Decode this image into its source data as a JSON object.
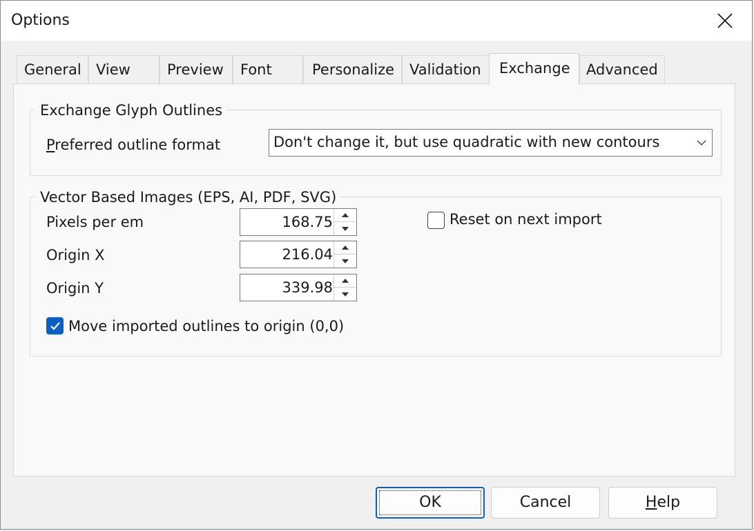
{
  "window": {
    "title": "Options"
  },
  "tabs": [
    {
      "label": "General"
    },
    {
      "label": "View"
    },
    {
      "label": "Preview"
    },
    {
      "label": "Font"
    },
    {
      "label": "Personalize"
    },
    {
      "label": "Validation"
    },
    {
      "label": "Exchange",
      "active": true
    },
    {
      "label": "Advanced"
    }
  ],
  "exchange_glyph": {
    "group_title": "Exchange Glyph Outlines",
    "format_label_accel": "P",
    "format_label_rest": "referred outline format",
    "format_value": "Don't change it, but use quadratic with new contours"
  },
  "vector_images": {
    "group_title": "Vector Based Images (EPS, AI, PDF, SVG)",
    "pixels_per_em_label": "Pixels per em",
    "pixels_per_em_value": "168.75",
    "origin_x_label": "Origin X",
    "origin_x_value": "216.04",
    "origin_y_label": "Origin Y",
    "origin_y_value": "339.98",
    "reset_label": "Reset on next import",
    "reset_checked": false,
    "move_label": "Move imported outlines to origin (0,0)",
    "move_checked": true
  },
  "buttons": {
    "ok": "OK",
    "cancel": "Cancel",
    "help_accel": "H",
    "help_rest": "elp"
  },
  "colors": {
    "accent": "#0a5fc4"
  }
}
